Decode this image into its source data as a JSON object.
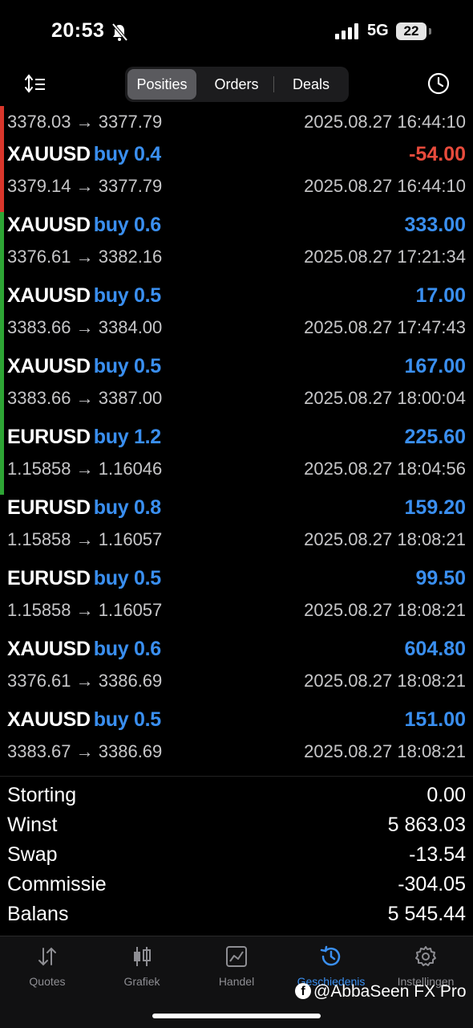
{
  "status_bar": {
    "time": "20:53",
    "network": "5G",
    "battery": "22"
  },
  "tabs": [
    "Posities",
    "Orders",
    "Deals"
  ],
  "active_tab": "Posities",
  "first_partial": {
    "prices": "3378.03 → 3377.79",
    "date": "2025.08.27 16:44:10"
  },
  "deals": [
    {
      "symbol": "XAUUSD",
      "type": "buy 0.4",
      "profit": "-54.00",
      "prices": "3379.14 → 3377.79",
      "date": "2025.08.27 16:44:10"
    },
    {
      "symbol": "XAUUSD",
      "type": "buy 0.6",
      "profit": "333.00",
      "prices": "3376.61 → 3382.16",
      "date": "2025.08.27 17:21:34"
    },
    {
      "symbol": "XAUUSD",
      "type": "buy 0.5",
      "profit": "17.00",
      "prices": "3383.66 → 3384.00",
      "date": "2025.08.27 17:47:43"
    },
    {
      "symbol": "XAUUSD",
      "type": "buy 0.5",
      "profit": "167.00",
      "prices": "3383.66 → 3387.00",
      "date": "2025.08.27 18:00:04"
    },
    {
      "symbol": "EURUSD",
      "type": "buy 1.2",
      "profit": "225.60",
      "prices": "1.15858 → 1.16046",
      "date": "2025.08.27 18:04:56"
    },
    {
      "symbol": "EURUSD",
      "type": "buy 0.8",
      "profit": "159.20",
      "prices": "1.15858 → 1.16057",
      "date": "2025.08.27 18:08:21"
    },
    {
      "symbol": "EURUSD",
      "type": "buy 0.5",
      "profit": "99.50",
      "prices": "1.15858 → 1.16057",
      "date": "2025.08.27 18:08:21"
    },
    {
      "symbol": "XAUUSD",
      "type": "buy 0.6",
      "profit": "604.80",
      "prices": "3376.61 → 3386.69",
      "date": "2025.08.27 18:08:21"
    },
    {
      "symbol": "XAUUSD",
      "type": "buy 0.5",
      "profit": "151.00",
      "prices": "3383.67 → 3386.69",
      "date": "2025.08.27 18:08:21"
    }
  ],
  "summary": [
    {
      "label": "Storting",
      "value": "0.00"
    },
    {
      "label": "Winst",
      "value": "5 863.03"
    },
    {
      "label": "Swap",
      "value": "-13.54"
    },
    {
      "label": "Commissie",
      "value": "-304.05"
    },
    {
      "label": "Balans",
      "value": "5 545.44"
    }
  ],
  "tabbar": {
    "quotes": "Quotes",
    "grafiek": "Grafiek",
    "handel": "Handel",
    "geschiedenis": "Geschiedenis",
    "instellingen": "Instellingen"
  },
  "watermark": "@AbbaSeen FX Pro",
  "colors": {
    "profit": "#3a8ff0",
    "loss": "#e84b3c",
    "bar_loss": "#d9362b",
    "bar_profit": "#2ea535",
    "accent": "#3a8ff0"
  }
}
